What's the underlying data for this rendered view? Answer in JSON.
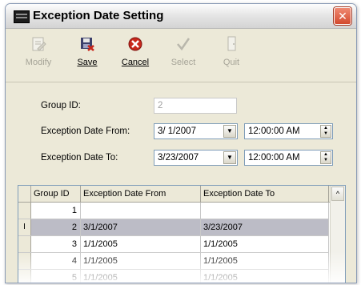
{
  "window": {
    "title": "Exception Date Setting",
    "close_label": "✕"
  },
  "toolbar": {
    "buttons": [
      {
        "label": "Modify",
        "icon": "modify-icon",
        "enabled": false
      },
      {
        "label": "Save",
        "icon": "save-icon",
        "enabled": true
      },
      {
        "label": "Cancel",
        "icon": "cancel-icon",
        "enabled": true
      },
      {
        "label": "Select",
        "icon": "checkmark-icon",
        "enabled": false
      },
      {
        "label": "Quit",
        "icon": "exit-door-icon",
        "enabled": false
      }
    ]
  },
  "form": {
    "group_id_label": "Group ID:",
    "group_id_value": "2",
    "from_label": "Exception Date From:",
    "from_date": "3/ 1/2007",
    "from_time": "12:00:00 AM",
    "to_label": "Exception Date To:",
    "to_date": "3/23/2007",
    "to_time": "12:00:00 AM"
  },
  "grid": {
    "columns": [
      "Group ID",
      "Exception Date From",
      "Exception Date To"
    ],
    "row_indicator": "I",
    "rows": [
      {
        "group_id": "1",
        "from": "",
        "to": ""
      },
      {
        "group_id": "2",
        "from": "3/1/2007",
        "to": "3/23/2007"
      },
      {
        "group_id": "3",
        "from": "1/1/2005",
        "to": "1/1/2005"
      },
      {
        "group_id": "4",
        "from": "1/1/2005",
        "to": "1/1/2005"
      },
      {
        "group_id": "5",
        "from": "1/1/2005",
        "to": "1/1/2005"
      }
    ],
    "selected_row": 1
  },
  "colors": {
    "window_bg": "#ece9d8",
    "selected_row": "#bcbcc6",
    "cancel_red": "#c8281c",
    "close_red": "#d34a2e"
  }
}
